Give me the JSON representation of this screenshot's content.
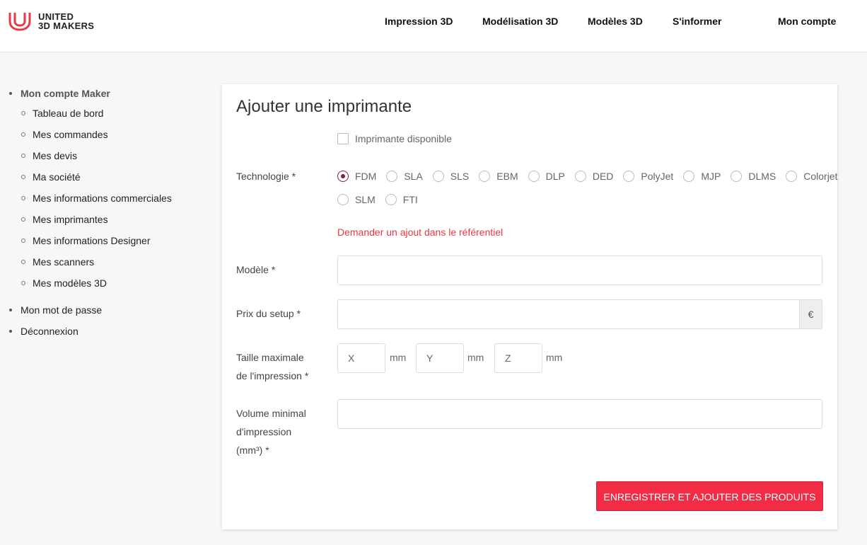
{
  "brand": {
    "line1": "UNITED",
    "line2": "3D MAKERS",
    "accent": "#e63946"
  },
  "nav": [
    "Impression 3D",
    "Modélisation 3D",
    "Modèles 3D",
    "S'informer",
    "Mon compte"
  ],
  "sidebar": {
    "section_maker": "Mon compte Maker",
    "items": [
      "Tableau de bord",
      "Mes commandes",
      "Mes devis",
      "Ma société",
      "Mes informations commerciales",
      "Mes imprimantes",
      "Mes informations Designer",
      "Mes scanners",
      "Mes modèles 3D"
    ],
    "password": "Mon mot de passe",
    "logout": "Déconnexion"
  },
  "form": {
    "title": "Ajouter une imprimante",
    "available_label": "Imprimante disponible",
    "technology_label": "Technologie *",
    "technologies_row1": [
      "FDM",
      "SLA",
      "SLS",
      "EBM",
      "DLP",
      "DED",
      "PolyJet",
      "MJP",
      "DLMS",
      "Colorjet"
    ],
    "technologies_row2": [
      "SLM",
      "FTI"
    ],
    "selected_technology": "FDM",
    "request_link": "Demander un ajout dans le référentiel",
    "model_label": "Modèle *",
    "model_value": "",
    "setup_price_label": "Prix du setup *",
    "setup_price_value": "",
    "currency": "€",
    "max_size_label_1": "Taille maximale",
    "max_size_label_2": "de l'impression *",
    "dim_x_placeholder": "X",
    "dim_y_placeholder": "Y",
    "dim_z_placeholder": "Z",
    "unit": "mm",
    "min_volume_label_1": "Volume minimal",
    "min_volume_label_2": "d'impression",
    "min_volume_label_3": "(mm³) *",
    "min_volume_value": "",
    "submit_label": "ENREGISTRER ET AJOUTER DES PRODUITS"
  }
}
